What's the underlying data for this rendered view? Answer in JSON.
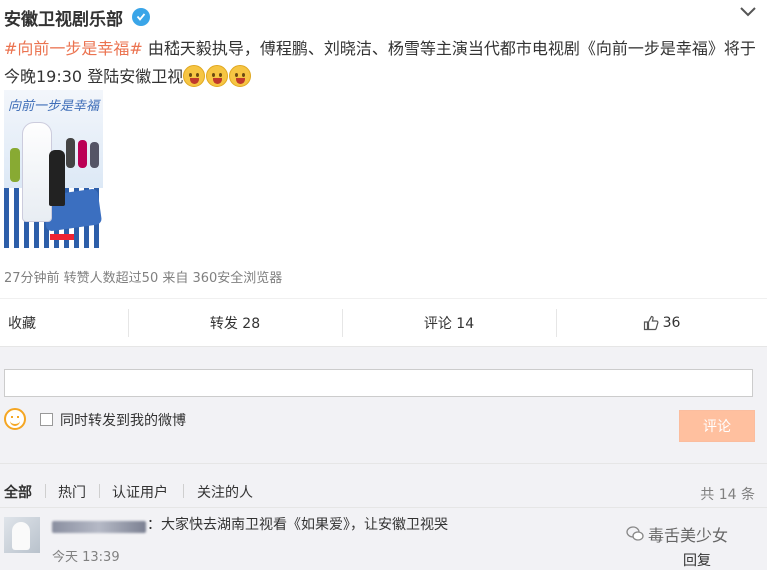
{
  "post": {
    "author": "安徽卫视剧乐部",
    "topic": "#向前一步是幸福#",
    "text": " 由嵇天毅执导，傅程鹏、刘晓洁、杨雪等主演当代都市电视剧《向前一步是幸福》将于今晚19:30 登陆安徽卫视",
    "image_text": "向前一步是幸福",
    "meta": "27分钟前 转赞人数超过50 来自 360安全浏览器",
    "emoji_count": 3,
    "icons": [
      "verified-badge-icon",
      "chevron-down-icon",
      "laughing-emoji-icon",
      "thumbs-up-icon"
    ]
  },
  "actions": {
    "favorite": "收藏",
    "repost": "转发 28",
    "comment": "评论 14",
    "like": "36"
  },
  "comment_box": {
    "input_value": "",
    "forward_label": "同时转发到我的微博",
    "submit": "评论"
  },
  "filters": {
    "all": "全部",
    "hot": "热门",
    "verified": "认证用户",
    "following": "关注的人",
    "total": "共 14 条"
  },
  "comments": [
    {
      "text": "：大家快去湖南卫视看《如果爱》，让安徽卫视哭",
      "time": "今天 13:39",
      "reply": "回复"
    }
  ],
  "watermark": "毒舌美少女",
  "colors": {
    "topic": "#eb7350",
    "submit_bg": "#ffc09f",
    "verified": "#3aa5e8"
  }
}
